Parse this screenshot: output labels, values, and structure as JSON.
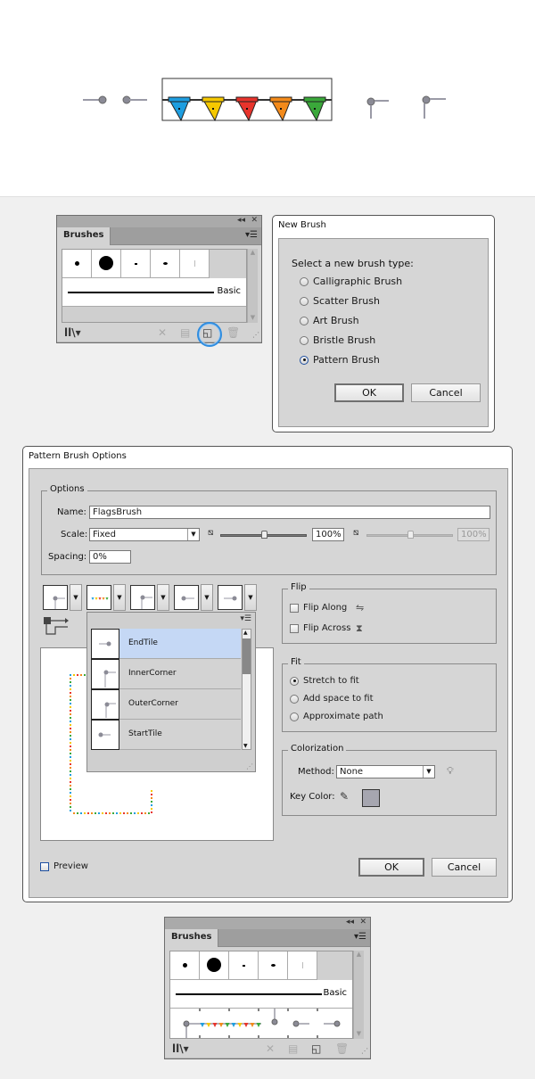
{
  "artboard": {
    "flag_colors": [
      "#1e9ee0",
      "#f5c800",
      "#e8342c",
      "#f38a1a",
      "#3aa83a"
    ]
  },
  "brushes_panel_1": {
    "collapse_icon": "◂◂",
    "close_icon": "✕",
    "tab_label": "Brushes",
    "menu_icon": "▾☰",
    "basic_label": "Basic",
    "footer": {
      "library_icon": "libraries-icon",
      "remove_stroke_icon": "remove-brush-stroke-icon",
      "options_icon": "options-icon",
      "new_brush_icon": "new-brush-icon",
      "delete_icon": "delete-brush-icon"
    },
    "highlighted": "new-brush-button"
  },
  "new_brush_dialog": {
    "title": "New Brush",
    "prompt": "Select a new brush type:",
    "options": [
      {
        "label": "Calligraphic Brush",
        "selected": false
      },
      {
        "label": "Scatter Brush",
        "selected": false
      },
      {
        "label": "Art Brush",
        "selected": false
      },
      {
        "label": "Bristle Brush",
        "selected": false
      },
      {
        "label": "Pattern Brush",
        "selected": true
      }
    ],
    "ok": "OK",
    "cancel": "Cancel"
  },
  "pattern_options": {
    "title": "Pattern Brush Options",
    "options_legend": "Options",
    "name_label": "Name:",
    "name_value": "FlagsBrush",
    "scale_label": "Scale:",
    "scale_value": "Fixed",
    "scale_pct": "100%",
    "scale_pct_disabled": "100%",
    "scale_fraction": 0.5,
    "spacing_label": "Spacing:",
    "spacing_value": "0%",
    "tiles_popup": {
      "items": [
        {
          "label": "EndTile",
          "selected": true
        },
        {
          "label": "InnerCorner",
          "selected": false
        },
        {
          "label": "OuterCorner",
          "selected": false
        },
        {
          "label": "StartTile",
          "selected": false
        }
      ]
    },
    "flip": {
      "legend": "Flip",
      "along": {
        "label": "Flip Along",
        "checked": false
      },
      "across": {
        "label": "Flip Across",
        "checked": false
      }
    },
    "fit": {
      "legend": "Fit",
      "options": [
        {
          "label": "Stretch to fit",
          "selected": true
        },
        {
          "label": "Add space to fit",
          "selected": false
        },
        {
          "label": "Approximate path",
          "selected": false
        }
      ]
    },
    "colorization": {
      "legend": "Colorization",
      "method_label": "Method:",
      "method_value": "None",
      "key_color_label": "Key Color:",
      "key_color": "#a6a6b0"
    },
    "preview_label": "Preview",
    "preview_checked": false,
    "ok": "OK",
    "cancel": "Cancel"
  },
  "brushes_panel_2": {
    "collapse_icon": "◂◂",
    "close_icon": "✕",
    "tab_label": "Brushes",
    "menu_icon": "▾☰",
    "basic_label": "Basic"
  }
}
